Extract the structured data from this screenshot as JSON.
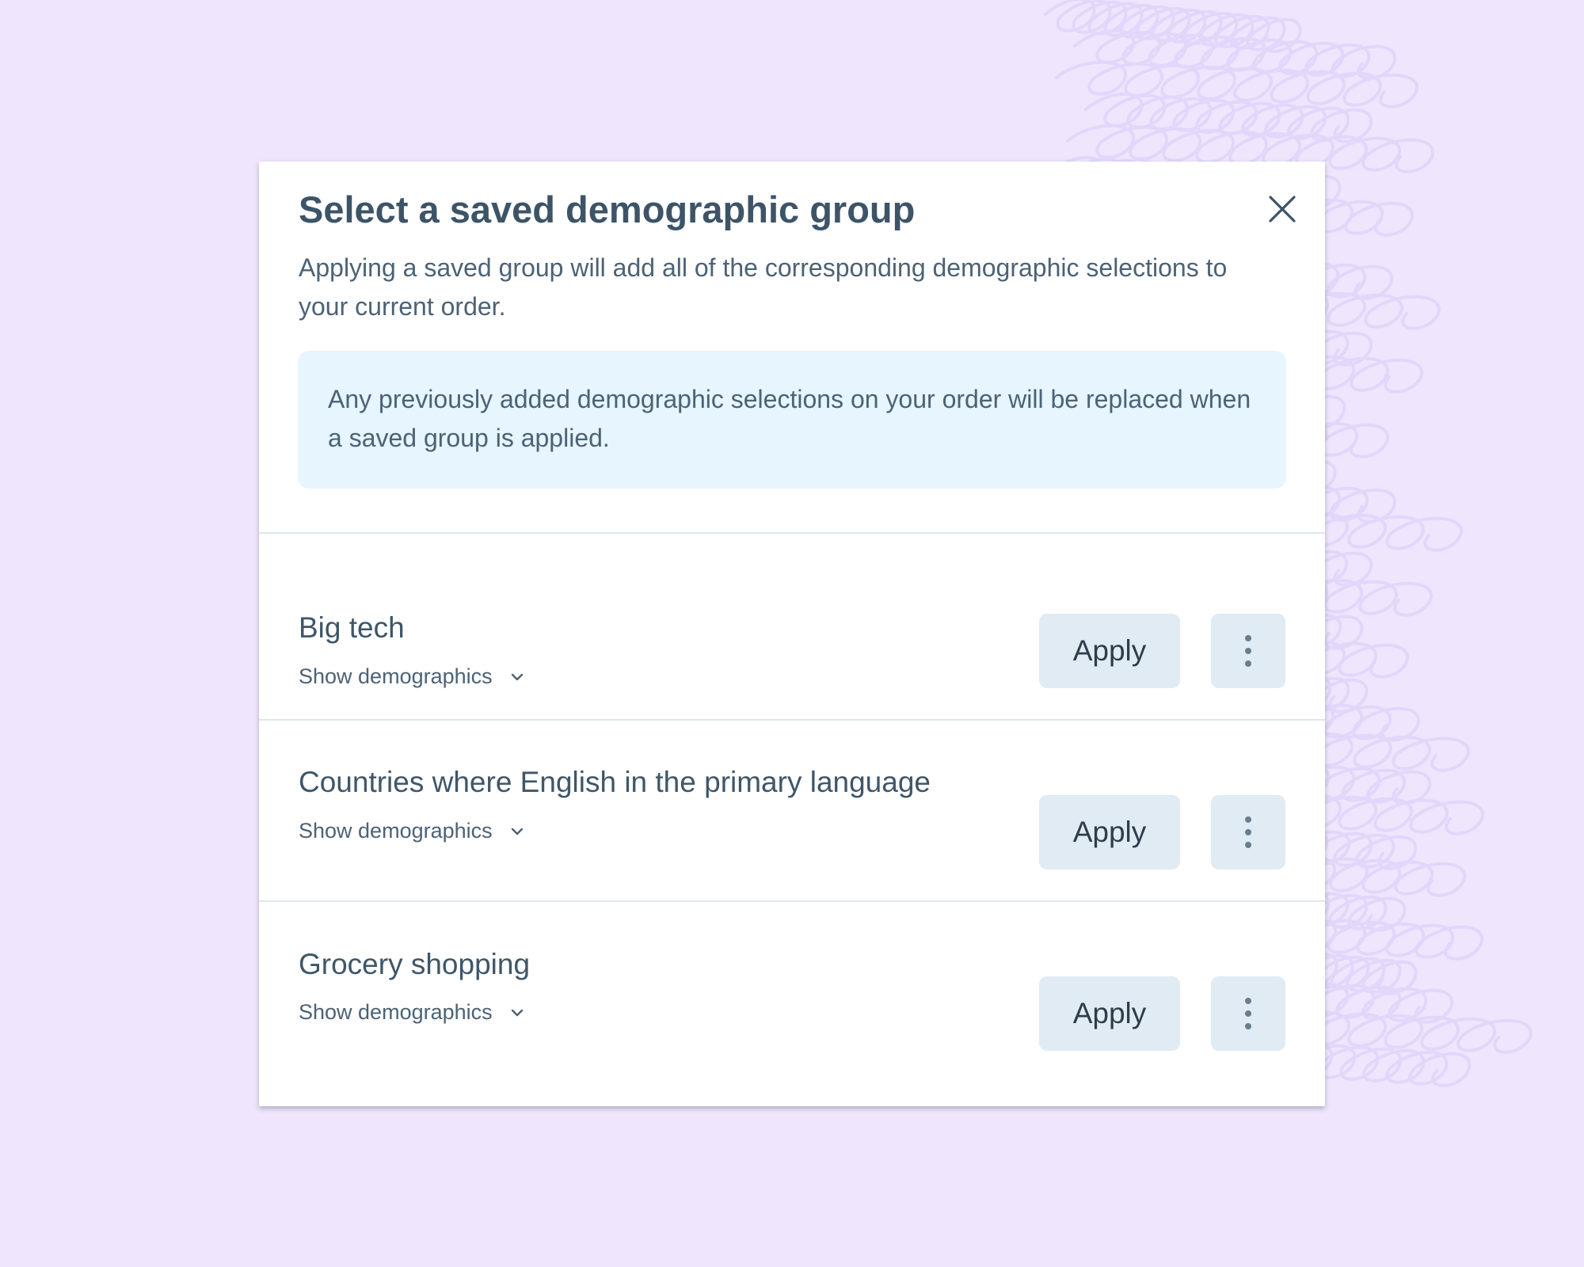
{
  "modal": {
    "title": "Select a saved demographic group",
    "description": "Applying a saved group will add all of the corresponding demographic selections to your current order.",
    "notice": "Any previously added demographic selections on your order will be replaced when a saved group is applied.",
    "close_icon": "close-icon"
  },
  "groups": [
    {
      "name": "Big tech",
      "toggle_label": "Show demographics",
      "apply_label": "Apply",
      "more_icon": "vertical-ellipsis-icon"
    },
    {
      "name": "Countries where English in the primary language",
      "toggle_label": "Show demographics",
      "apply_label": "Apply",
      "more_icon": "vertical-ellipsis-icon"
    },
    {
      "name": "Grocery shopping",
      "toggle_label": "Show demographics",
      "apply_label": "Apply",
      "more_icon": "vertical-ellipsis-icon"
    }
  ],
  "colors": {
    "page_background": "#efe6fd",
    "modal_background": "#ffffff",
    "notice_background": "#e6f5fe",
    "button_background": "#e1ebf3",
    "title_text": "#3d5468",
    "body_text": "#4c6276"
  }
}
